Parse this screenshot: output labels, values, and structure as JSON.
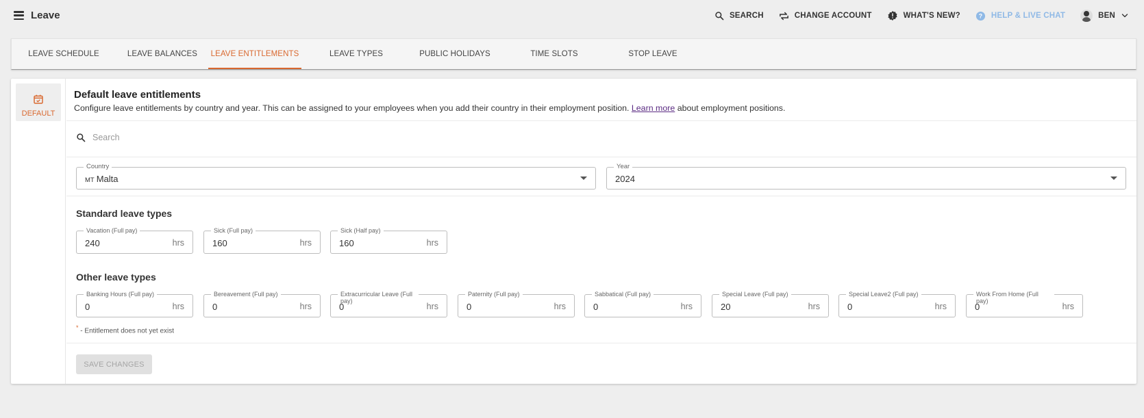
{
  "app": {
    "title": "Leave"
  },
  "topnav": {
    "search": "SEARCH",
    "change_account": "CHANGE ACCOUNT",
    "whats_new": "WHAT'S NEW?",
    "help": "HELP & LIVE CHAT",
    "user": "BEN"
  },
  "tabs": [
    {
      "label": "LEAVE SCHEDULE",
      "active": false
    },
    {
      "label": "LEAVE BALANCES",
      "active": false
    },
    {
      "label": "LEAVE ENTITLEMENTS",
      "active": true
    },
    {
      "label": "LEAVE TYPES",
      "active": false
    },
    {
      "label": "PUBLIC HOLIDAYS",
      "active": false
    },
    {
      "label": "TIME SLOTS",
      "active": false
    },
    {
      "label": "STOP LEAVE",
      "active": false
    }
  ],
  "sidebar": {
    "default_label": "DEFAULT"
  },
  "header": {
    "title": "Default leave entitlements",
    "desc_before": "Configure leave entitlements by country and year. This can be assigned to your employees when you add their country in their employment position.",
    "learn_more": "Learn more",
    "desc_after": "about employment positions."
  },
  "search": {
    "placeholder": "Search"
  },
  "filters": {
    "country_label": "Country",
    "country_code": "MT",
    "country_value": "Malta",
    "year_label": "Year",
    "year_value": "2024"
  },
  "standard": {
    "title": "Standard leave types",
    "fields": [
      {
        "label": "Vacation (Full pay)",
        "value": "240",
        "unit": "hrs"
      },
      {
        "label": "Sick (Full pay)",
        "value": "160",
        "unit": "hrs"
      },
      {
        "label": "Sick (Half pay)",
        "value": "160",
        "unit": "hrs"
      }
    ]
  },
  "other": {
    "title": "Other leave types",
    "fields": [
      {
        "label": "Banking Hours (Full pay)",
        "value": "0",
        "unit": "hrs"
      },
      {
        "label": "Bereavement (Full pay)",
        "value": "0",
        "unit": "hrs"
      },
      {
        "label": "Extracurricular Leave (Full pay)",
        "value": "0",
        "unit": "hrs"
      },
      {
        "label": "Paternity (Full pay)",
        "value": "0",
        "unit": "hrs"
      },
      {
        "label": "Sabbatical (Full pay)",
        "value": "0",
        "unit": "hrs"
      },
      {
        "label": "Special Leave (Full pay)",
        "value": "20",
        "unit": "hrs"
      },
      {
        "label": "Special Leave2 (Full pay)",
        "value": "0",
        "unit": "hrs"
      },
      {
        "label": "Work From Home (Full pay)",
        "value": "0",
        "unit": "hrs"
      }
    ]
  },
  "note": {
    "marker": "*",
    "text": "- Entitlement does not yet exist"
  },
  "actions": {
    "save": "SAVE CHANGES"
  },
  "colors": {
    "accent": "#d9682f",
    "help": "#8fb9e6",
    "link": "#5a2a82"
  }
}
